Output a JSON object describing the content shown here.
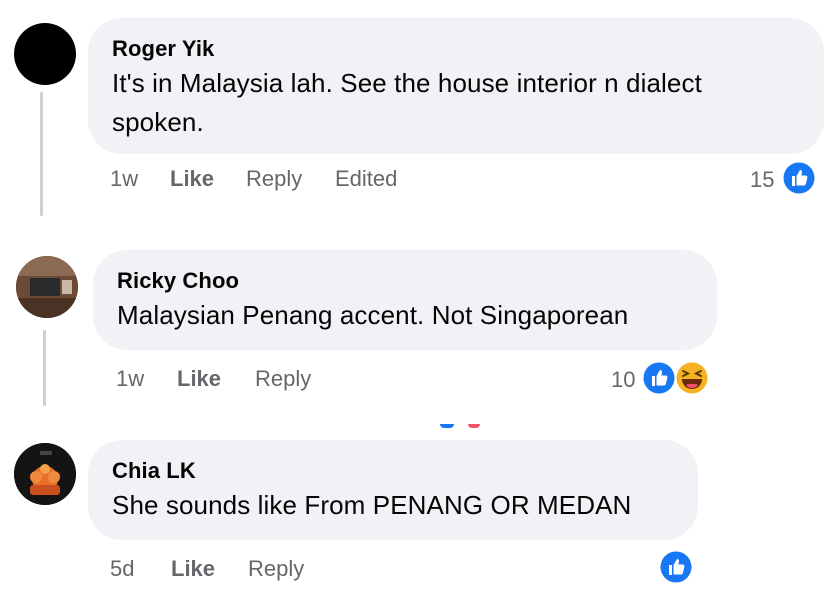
{
  "comments": [
    {
      "name": "Roger Yik",
      "text_line1": "It's in Malaysia lah. See the house interior n dialect",
      "text_line2": "spoken.",
      "time": "1w",
      "like": "Like",
      "reply": "Reply",
      "edited": "Edited",
      "reaction_count": "15",
      "reactions": [
        "like-icon"
      ]
    },
    {
      "name": "Ricky Choo",
      "text_line1": "Malaysian Penang accent. Not Singaporean",
      "time": "1w",
      "like": "Like",
      "reply": "Reply",
      "reaction_count": "10",
      "reactions": [
        "like-icon",
        "haha-icon"
      ]
    },
    {
      "name": "Chia LK",
      "text_line1": "She sounds like From PENANG OR MEDAN",
      "time": "5d",
      "like": "Like",
      "reply": "Reply",
      "reaction_count": "",
      "reactions": [
        "like-icon"
      ]
    }
  ],
  "colors": {
    "like_blue": "#1877f2",
    "bubble_bg": "#f0f2f5",
    "meta_gray": "#65676b",
    "haha_yellow": "#f7b125"
  }
}
